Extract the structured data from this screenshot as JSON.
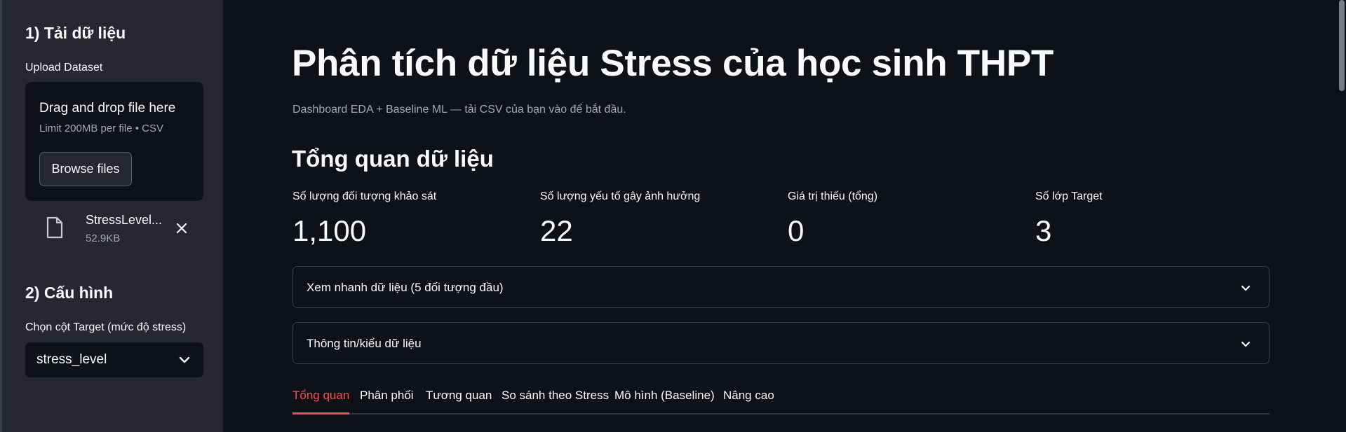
{
  "sidebar": {
    "section1_title": "1) Tải dữ liệu",
    "upload_label": "Upload Dataset",
    "dropzone": {
      "title": "Drag and drop file here",
      "subtitle": "Limit 200MB per file • CSV",
      "browse_label": "Browse files"
    },
    "file": {
      "name": "StressLevel...",
      "size": "52.9KB",
      "icon": "file-icon"
    },
    "section2_title": "2) Cấu hình",
    "target_label": "Chọn cột Target (mức độ stress)",
    "target_value": "stress_level"
  },
  "main": {
    "title": "Phân tích dữ liệu Stress của học sinh THPT",
    "subtitle": "Dashboard EDA + Baseline ML — tải CSV của bạn vào để bắt đầu.",
    "overview_title": "Tổng quan dữ liệu",
    "metrics": [
      {
        "label": "Số lượng đối tượng khảo sát",
        "value": "1,100"
      },
      {
        "label": "Số lượng yếu tố gây ảnh hưởng",
        "value": "22"
      },
      {
        "label": "Giá trị thiếu (tổng)",
        "value": "0"
      },
      {
        "label": "Số lớp Target",
        "value": "3"
      }
    ],
    "expanders": [
      {
        "label": "Xem nhanh dữ liệu (5 đối tượng đầu)"
      },
      {
        "label": "Thông tin/kiểu dữ liệu"
      }
    ],
    "tabs": [
      {
        "label": "Tổng quan",
        "active": true
      },
      {
        "label": "Phân phối"
      },
      {
        "label": "Tương quan"
      },
      {
        "label": "So sánh theo Stress"
      },
      {
        "label": "Mô hình (Baseline)"
      },
      {
        "label": "Nâng cao"
      }
    ]
  },
  "colors": {
    "background": "#0e1117",
    "sidebar": "#262730",
    "accent": "#ff4b4b",
    "muted_text": "#a3a8b8"
  }
}
